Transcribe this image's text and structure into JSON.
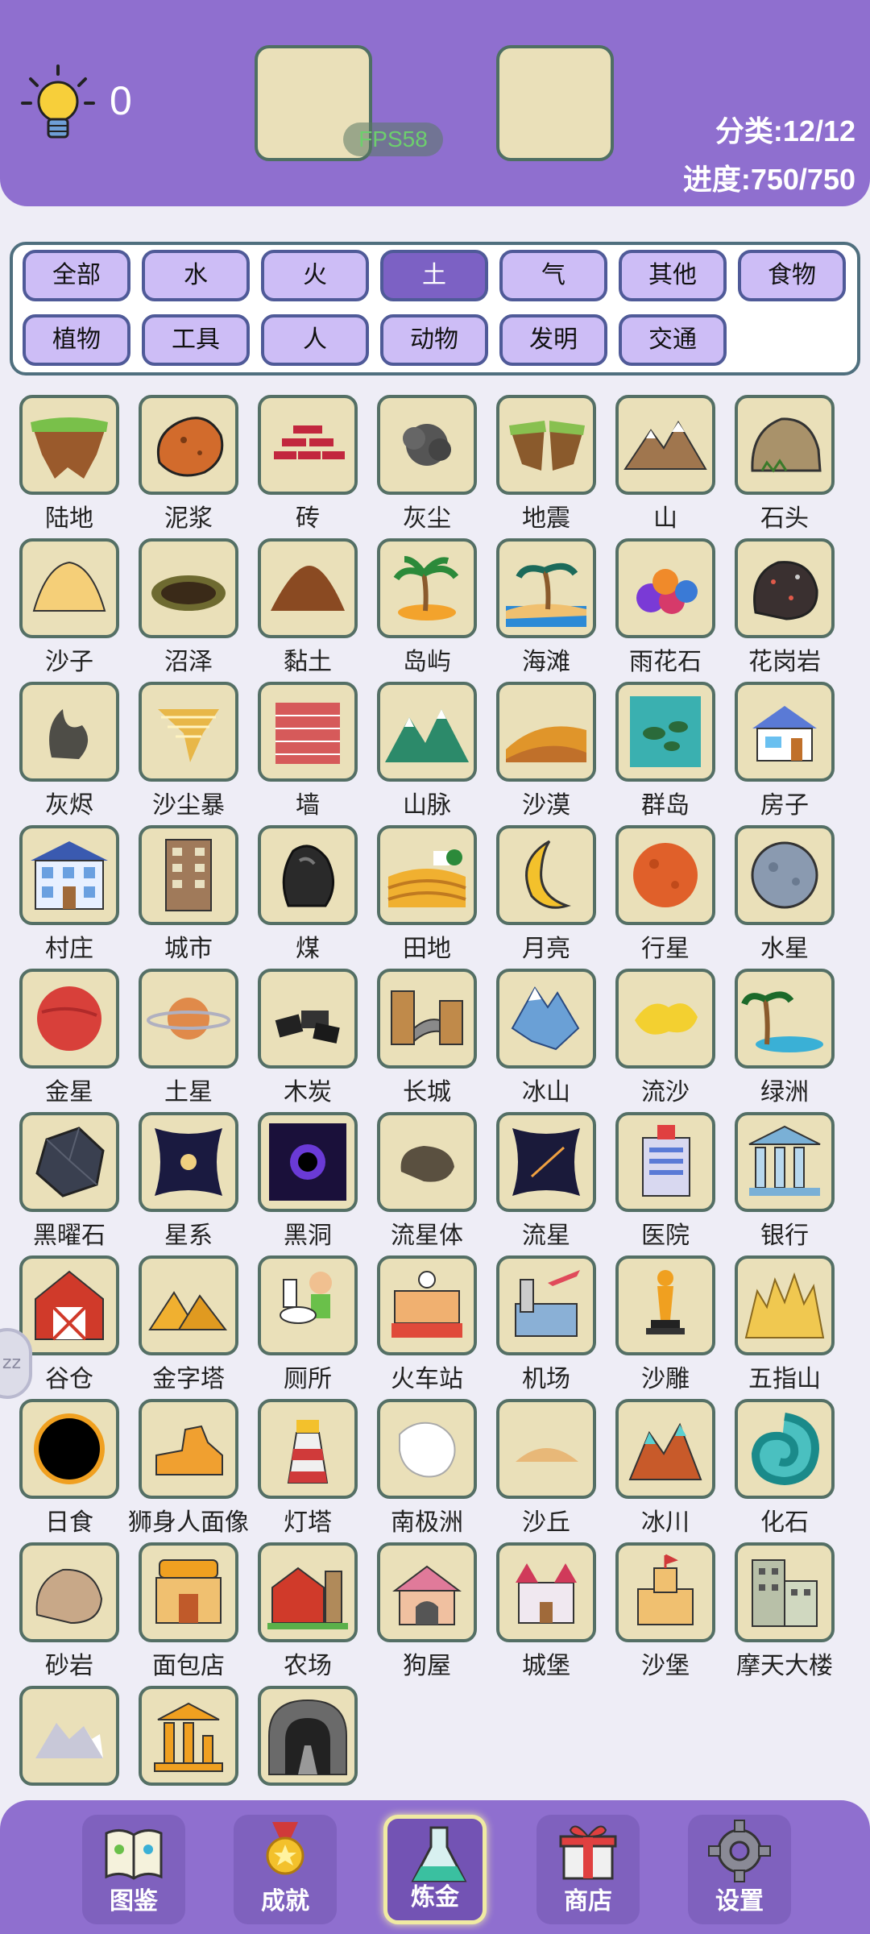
{
  "header": {
    "hint_count": "0",
    "fps": "FPS58",
    "category_stat": "分类:12/12",
    "progress_stat": "进度:750/750"
  },
  "categories": [
    "全部",
    "水",
    "火",
    "土",
    "气",
    "其他",
    "食物",
    "植物",
    "工具",
    "人",
    "动物",
    "发明",
    "交通"
  ],
  "active_category": "土",
  "items": [
    "陆地",
    "泥浆",
    "砖",
    "灰尘",
    "地震",
    "山",
    "石头",
    "沙子",
    "沼泽",
    "黏土",
    "岛屿",
    "海滩",
    "雨花石",
    "花岗岩",
    "灰烬",
    "沙尘暴",
    "墙",
    "山脉",
    "沙漠",
    "群岛",
    "房子",
    "村庄",
    "城市",
    "煤",
    "田地",
    "月亮",
    "行星",
    "水星",
    "金星",
    "土星",
    "木炭",
    "长城",
    "冰山",
    "流沙",
    "绿洲",
    "黑曜石",
    "星系",
    "黑洞",
    "流星体",
    "流星",
    "医院",
    "银行",
    "谷仓",
    "金字塔",
    "厕所",
    "火车站",
    "机场",
    "沙雕",
    "五指山",
    "日食",
    "狮身人面像",
    "灯塔",
    "南极洲",
    "沙丘",
    "冰川",
    "化石",
    "砂岩",
    "面包店",
    "农场",
    "狗屋",
    "城堡",
    "沙堡",
    "摩天大楼",
    "",
    "",
    ""
  ],
  "side_tab": "zz",
  "nav": [
    {
      "label": "图鉴",
      "icon": "book-icon"
    },
    {
      "label": "成就",
      "icon": "medal-icon"
    },
    {
      "label": "炼金",
      "icon": "flask-icon"
    },
    {
      "label": "商店",
      "icon": "gift-icon"
    },
    {
      "label": "设置",
      "icon": "gear-icon"
    }
  ],
  "colors": {
    "accent": "#8f6fcf",
    "tile": "#eae0b9",
    "tile_border": "#546f65",
    "category_active": "#7c61c4"
  }
}
